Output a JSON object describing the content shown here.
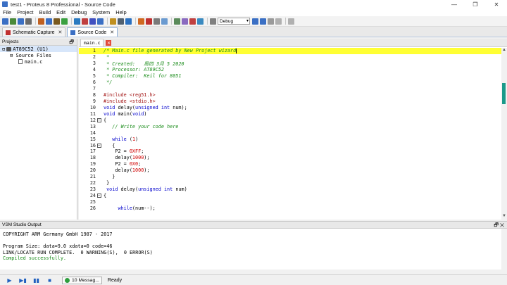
{
  "window": {
    "title": "test1 - Proteus 8 Professional - Source Code",
    "minimize": "—",
    "restore": "❐",
    "close": "✕"
  },
  "menu": [
    "File",
    "Project",
    "Build",
    "Edit",
    "Debug",
    "System",
    "Help"
  ],
  "toolbar": {
    "icon_colors_left": [
      "#3a6fc4",
      "#4a8a3a",
      "#3a6fc4",
      "#6a6a6a",
      "#c06020",
      "#3a6fc4",
      "#7a5a20",
      "#3aa040",
      "#2a7ac0",
      "#c04040",
      "#4050c0",
      "#3a6fc4",
      "#c09020",
      "#506070",
      "#2a70c0"
    ],
    "icon_colors_right": [
      "#d06820",
      "#c03030",
      "#7a7a7a",
      "#6a9ad0",
      "#5a8a5a",
      "#8a6ac0",
      "#c04040",
      "#3a8ac0",
      "#808080"
    ],
    "config_value": "Debug",
    "icon_colors_tail": [
      "#3a6fc4",
      "#3a6fc4",
      "#9a9a9a",
      "#b0b0b0",
      "#b0b0b0"
    ]
  },
  "doc_tabs": [
    {
      "label": "Schematic Capture",
      "close": "✕",
      "icon_color": "#c03030"
    },
    {
      "label": "Source Code",
      "close": "✕",
      "icon_color": "#3a6fc4"
    }
  ],
  "projects": {
    "header": "Projects",
    "pin": "🗗",
    "tree": [
      {
        "toggle": "⊟",
        "label": "AT89C52 (U1)",
        "indent": 0,
        "selected": true
      },
      {
        "toggle": "⊟",
        "label": "Source Files",
        "indent": 1,
        "selected": false
      },
      {
        "toggle": "",
        "label": "main.c",
        "indent": 2,
        "selected": false
      }
    ]
  },
  "editor": {
    "tab": "main.c",
    "close": "✕",
    "lines": [
      {
        "n": "1",
        "fold": "",
        "hl": true,
        "parts": [
          [
            "com",
            "/* Main.c file generated by New Project wizard"
          ]
        ],
        "cursor": true
      },
      {
        "n": "2",
        "fold": "",
        "parts": [
          [
            "com",
            " *"
          ]
        ]
      },
      {
        "n": "3",
        "fold": "",
        "parts": [
          [
            "com",
            " * Created:   周四 3月 5 2020"
          ]
        ]
      },
      {
        "n": "4",
        "fold": "",
        "parts": [
          [
            "com",
            " * Processor: AT89C52"
          ]
        ]
      },
      {
        "n": "5",
        "fold": "",
        "parts": [
          [
            "com",
            " * Compiler:  Keil for 8051"
          ]
        ]
      },
      {
        "n": "6",
        "fold": "",
        "parts": [
          [
            "com",
            " */"
          ]
        ]
      },
      {
        "n": "7",
        "fold": "",
        "parts": []
      },
      {
        "n": "8",
        "fold": "",
        "parts": [
          [
            "pre",
            "#include <reg51.h>"
          ]
        ]
      },
      {
        "n": "9",
        "fold": "",
        "parts": [
          [
            "pre",
            "#include <stdio.h>"
          ]
        ]
      },
      {
        "n": "10",
        "fold": "",
        "parts": [
          [
            "kw",
            "void"
          ],
          [
            "plain",
            " delay("
          ],
          [
            "kw",
            "unsigned int"
          ],
          [
            "plain",
            " num);"
          ]
        ]
      },
      {
        "n": "11",
        "fold": "",
        "parts": [
          [
            "kw",
            "void"
          ],
          [
            "plain",
            " main("
          ],
          [
            "kw",
            "void"
          ],
          [
            "plain",
            ")"
          ]
        ]
      },
      {
        "n": "12",
        "fold": "−",
        "parts": [
          [
            "plain",
            "{"
          ]
        ]
      },
      {
        "n": "13",
        "fold": "",
        "parts": [
          [
            "com",
            "   // Write your code here"
          ]
        ]
      },
      {
        "n": "14",
        "fold": "",
        "parts": []
      },
      {
        "n": "15",
        "fold": "",
        "parts": [
          [
            "kw",
            "   while"
          ],
          [
            "plain",
            " ("
          ],
          [
            "num",
            "1"
          ],
          [
            "plain",
            ")"
          ]
        ]
      },
      {
        "n": "16",
        "fold": "−",
        "parts": [
          [
            "plain",
            "   {"
          ]
        ]
      },
      {
        "n": "17",
        "fold": "",
        "parts": [
          [
            "plain",
            "    P2 = "
          ],
          [
            "num",
            "0XFF"
          ],
          [
            "plain",
            ";"
          ]
        ]
      },
      {
        "n": "18",
        "fold": "",
        "parts": [
          [
            "plain",
            "    delay("
          ],
          [
            "num",
            "1000"
          ],
          [
            "plain",
            ");"
          ]
        ]
      },
      {
        "n": "19",
        "fold": "",
        "parts": [
          [
            "plain",
            "    P2 = "
          ],
          [
            "num",
            "0X0"
          ],
          [
            "plain",
            ";"
          ]
        ]
      },
      {
        "n": "20",
        "fold": "",
        "parts": [
          [
            "plain",
            "    delay("
          ],
          [
            "num",
            "1000"
          ],
          [
            "plain",
            ");"
          ]
        ]
      },
      {
        "n": "21",
        "fold": "",
        "parts": [
          [
            "plain",
            "   }"
          ]
        ]
      },
      {
        "n": "22",
        "fold": "",
        "parts": [
          [
            "plain",
            " }"
          ]
        ]
      },
      {
        "n": "23",
        "fold": "",
        "parts": [
          [
            "kw",
            " void"
          ],
          [
            "plain",
            " delay("
          ],
          [
            "kw",
            "unsigned int"
          ],
          [
            "plain",
            " num)"
          ]
        ]
      },
      {
        "n": "24",
        "fold": "−",
        "parts": [
          [
            "plain",
            "{"
          ]
        ]
      },
      {
        "n": "25",
        "fold": "",
        "parts": []
      },
      {
        "n": "26",
        "fold": "",
        "parts": [
          [
            "kw",
            "     while"
          ],
          [
            "plain",
            "(num--);"
          ]
        ]
      }
    ]
  },
  "output": {
    "header": "VSM Studio Output",
    "controls": "🗗 ✕",
    "lines": [
      {
        "text": "COPYRIGHT ARM Germany GmbH 1987 - 2017",
        "ok": false
      },
      {
        "text": "",
        "ok": false
      },
      {
        "text": "Program Size: data=9.0 xdata=0 code=46",
        "ok": false
      },
      {
        "text": "LINK/LOCATE RUN COMPLETE.  0 WARNING(S),  0 ERROR(S)",
        "ok": false
      },
      {
        "text": "Compiled successfully.",
        "ok": true
      }
    ]
  },
  "status": {
    "sim_buttons": [
      {
        "name": "run-simulation-button",
        "glyph": "▶"
      },
      {
        "name": "step-simulation-button",
        "glyph": "▶▮"
      },
      {
        "name": "pause-simulation-button",
        "glyph": "▮▮"
      },
      {
        "name": "stop-simulation-button",
        "glyph": "■"
      }
    ],
    "messages": "10 Messag...",
    "ready": "Ready"
  }
}
